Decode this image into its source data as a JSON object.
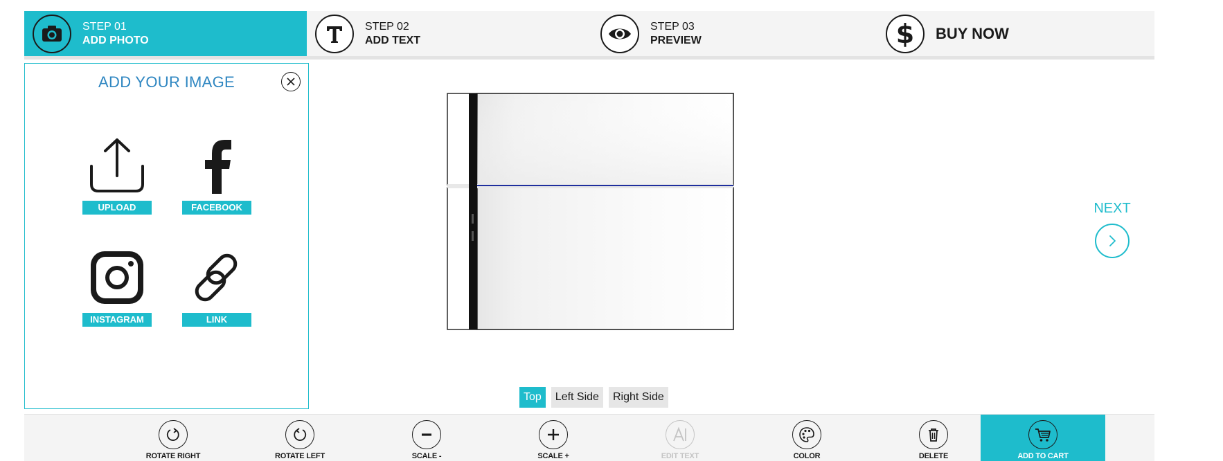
{
  "steps": [
    {
      "num": "STEP 01",
      "label": "ADD PHOTO",
      "icon": "camera-icon"
    },
    {
      "num": "STEP 02",
      "label": "ADD TEXT",
      "icon": "text-t-icon"
    },
    {
      "num": "STEP 03",
      "label": "PREVIEW",
      "icon": "eye-icon"
    },
    {
      "label": "BUY NOW",
      "icon": "dollar-icon"
    }
  ],
  "panel": {
    "title": "ADD YOUR IMAGE",
    "sources": [
      {
        "label": "UPLOAD",
        "icon": "upload-icon"
      },
      {
        "label": "FACEBOOK",
        "icon": "facebook-icon"
      },
      {
        "label": "INSTAGRAM",
        "icon": "instagram-icon"
      },
      {
        "label": "LINK",
        "icon": "link-icon"
      }
    ]
  },
  "next": {
    "label": "NEXT"
  },
  "side_tabs": [
    {
      "label": "Top",
      "selected": true
    },
    {
      "label": "Left Side",
      "selected": false
    },
    {
      "label": "Right Side",
      "selected": false
    }
  ],
  "toolbar": [
    {
      "label": "ROTATE RIGHT",
      "icon": "rotate-right-icon"
    },
    {
      "label": "ROTATE LEFT",
      "icon": "rotate-left-icon"
    },
    {
      "label": "SCALE -",
      "icon": "minus-icon"
    },
    {
      "label": "SCALE +",
      "icon": "plus-icon"
    },
    {
      "label": "EDIT TEXT",
      "icon": "edit-text-icon",
      "disabled": true
    },
    {
      "label": "COLOR",
      "icon": "palette-icon"
    },
    {
      "label": "DELETE",
      "icon": "trash-icon"
    },
    {
      "label": "ADD TO CART",
      "icon": "cart-icon",
      "active": true
    }
  ],
  "colors": {
    "accent": "#1ebccc",
    "title_blue": "#2e86c1",
    "bar_bg": "#f4f4f4"
  }
}
